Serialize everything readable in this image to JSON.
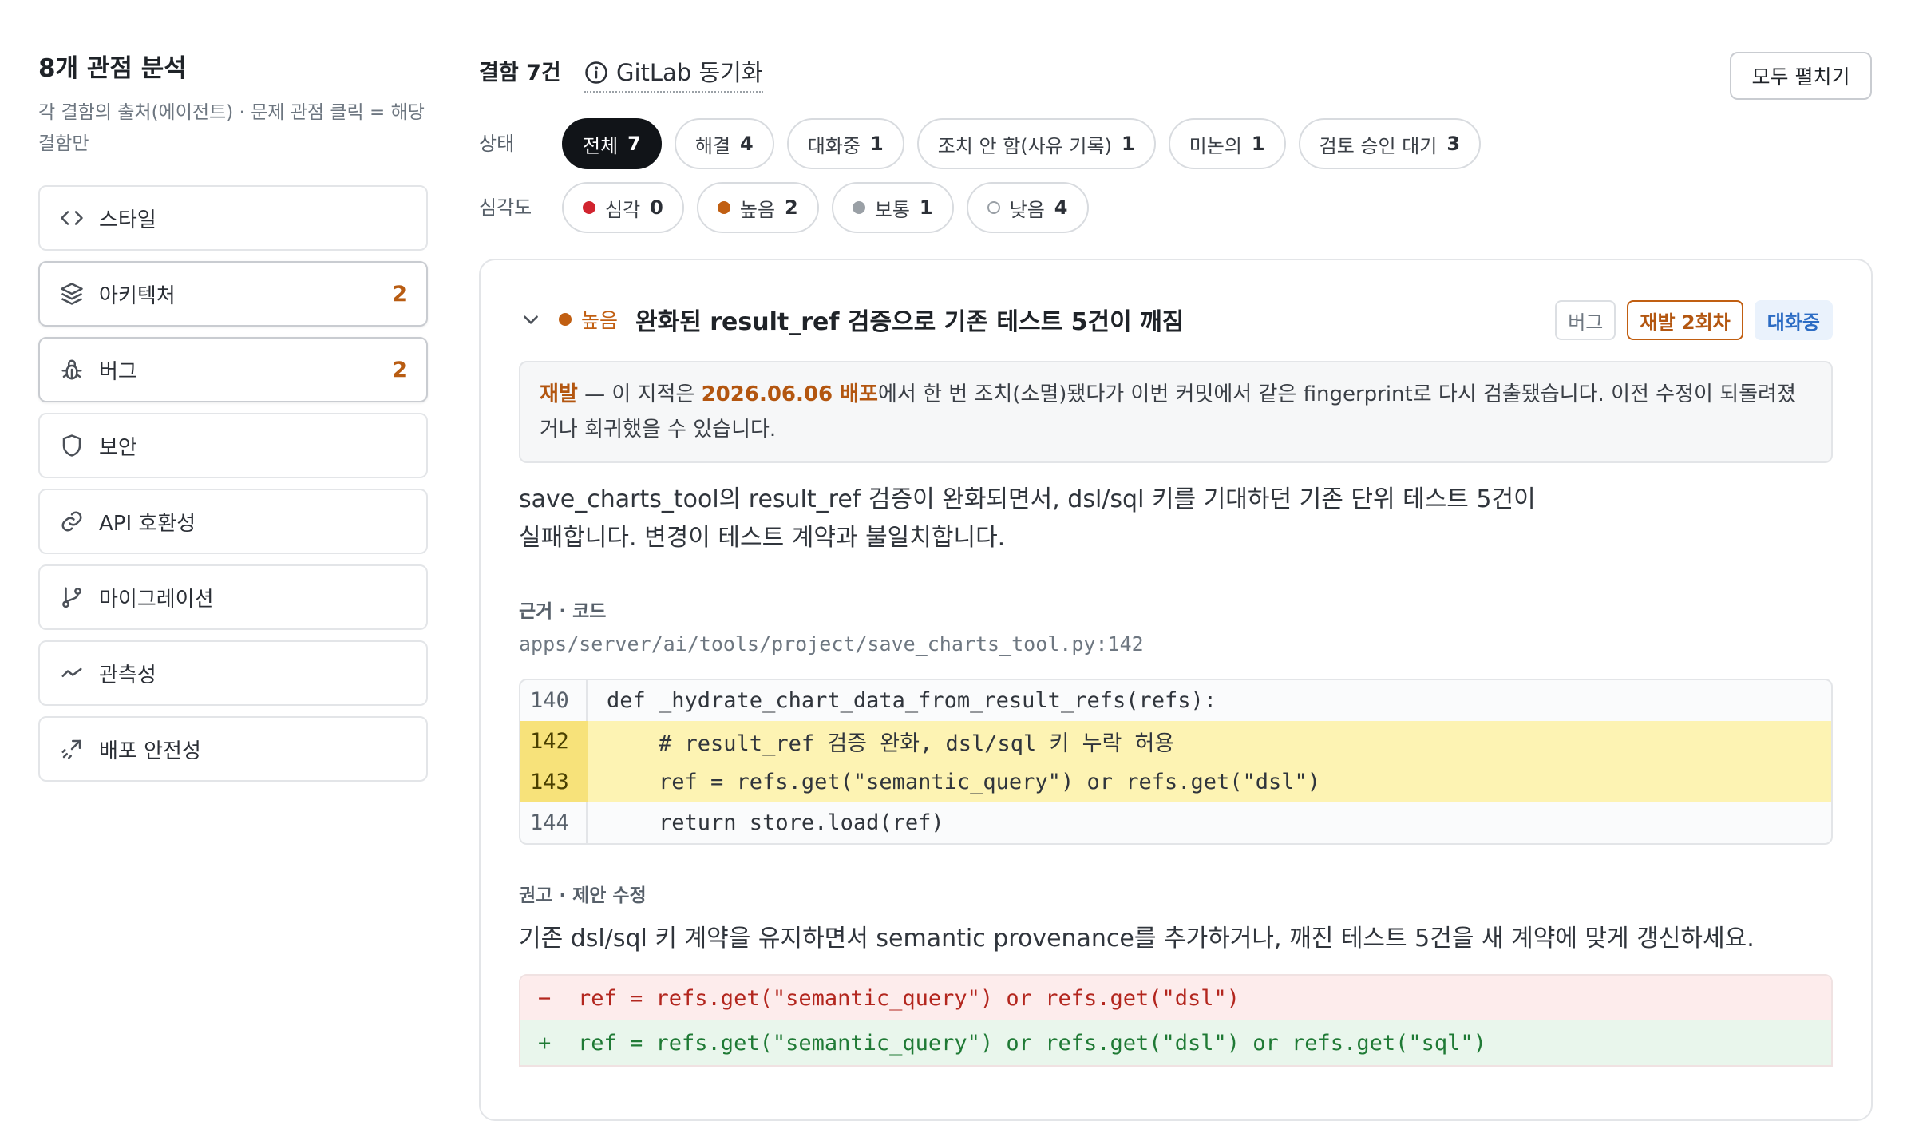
{
  "sidebar": {
    "title": "8개 관점 분석",
    "subtitle": "각 결함의 출처(에이전트) · 문제 관점 클릭 = 해당 결함만",
    "items": [
      {
        "label": "스타일",
        "icon": "code-brackets-icon",
        "count": ""
      },
      {
        "label": "아키텍처",
        "icon": "layers-icon",
        "count": "2"
      },
      {
        "label": "버그",
        "icon": "bug-icon",
        "count": "2"
      },
      {
        "label": "보안",
        "icon": "shield-icon",
        "count": ""
      },
      {
        "label": "API 호환성",
        "icon": "link-icon",
        "count": ""
      },
      {
        "label": "마이그레이션",
        "icon": "git-branch-icon",
        "count": ""
      },
      {
        "label": "관측성",
        "icon": "activity-icon",
        "count": ""
      },
      {
        "label": "배포 안전성",
        "icon": "rocket-icon",
        "count": ""
      }
    ]
  },
  "header": {
    "title": "결함 7건",
    "sync_label": "GitLab 동기화",
    "expand_all": "모두 펼치기"
  },
  "filters": {
    "status_label": "상태",
    "status": [
      {
        "label": "전체",
        "count": "7",
        "active": true
      },
      {
        "label": "해결",
        "count": "4"
      },
      {
        "label": "대화중",
        "count": "1"
      },
      {
        "label": "조치 안 함(사유 기록)",
        "count": "1"
      },
      {
        "label": "미논의",
        "count": "1"
      },
      {
        "label": "검토 승인 대기",
        "count": "3"
      }
    ],
    "severity_label": "심각도",
    "severity": [
      {
        "label": "심각",
        "count": "0",
        "color": "#d1242f",
        "hollow": false
      },
      {
        "label": "높음",
        "count": "2",
        "color": "#c15f12",
        "hollow": false
      },
      {
        "label": "보통",
        "count": "1",
        "color": "#9aa0a6",
        "hollow": false
      },
      {
        "label": "낮음",
        "count": "4",
        "color": "#9aa0a6",
        "hollow": true
      }
    ]
  },
  "finding": {
    "severity": "높음",
    "title": "완화된 result_ref 검증으로 기존 테스트 5건이 깨짐",
    "tags": {
      "category": "버그",
      "recurrence": "재발 2회차",
      "status": "대화중"
    },
    "notice": {
      "lead": "재발",
      "pre": " — 이 지적은 ",
      "date": "2026.06.06 배포",
      "post": "에서 한 번 조치(소멸)됐다가 이번 커밋에서 같은 fingerprint로 다시 검출됐습니다. 이전 수정이 되돌려졌거나 회귀했을 수 있습니다."
    },
    "description": "save_charts_tool의 result_ref 검증이 완화되면서, dsl/sql 키를 기대하던 기존 단위 테스트 5건이 실패합니다. 변경이 테스트 계약과 불일치합니다.",
    "evidence_label": "근거 · 코드",
    "file_path": "apps/server/ai/tools/project/save_charts_tool.py:142",
    "code": [
      {
        "line": "140",
        "text": "def _hydrate_chart_data_from_result_refs(refs):",
        "highlight": false
      },
      {
        "line": "142",
        "text": "    # result_ref 검증 완화, dsl/sql 키 누락 허용",
        "highlight": true
      },
      {
        "line": "143",
        "text": "    ref = refs.get(\"semantic_query\") or refs.get(\"dsl\")",
        "highlight": true
      },
      {
        "line": "144",
        "text": "    return store.load(ref)",
        "highlight": false
      }
    ],
    "recommend_label": "권고 · 제안 수정",
    "recommendation": "기존 dsl/sql 키 계약을 유지하면서 semantic provenance를 추가하거나, 깨진 테스트 5건을 새 계약에 맞게 갱신하세요.",
    "diff": [
      {
        "sign": "−",
        "text": "ref = refs.get(\"semantic_query\") or refs.get(\"dsl\")",
        "type": "del"
      },
      {
        "sign": "+",
        "text": "ref = refs.get(\"semantic_query\") or refs.get(\"dsl\") or refs.get(\"sql\")",
        "type": "add"
      }
    ]
  }
}
